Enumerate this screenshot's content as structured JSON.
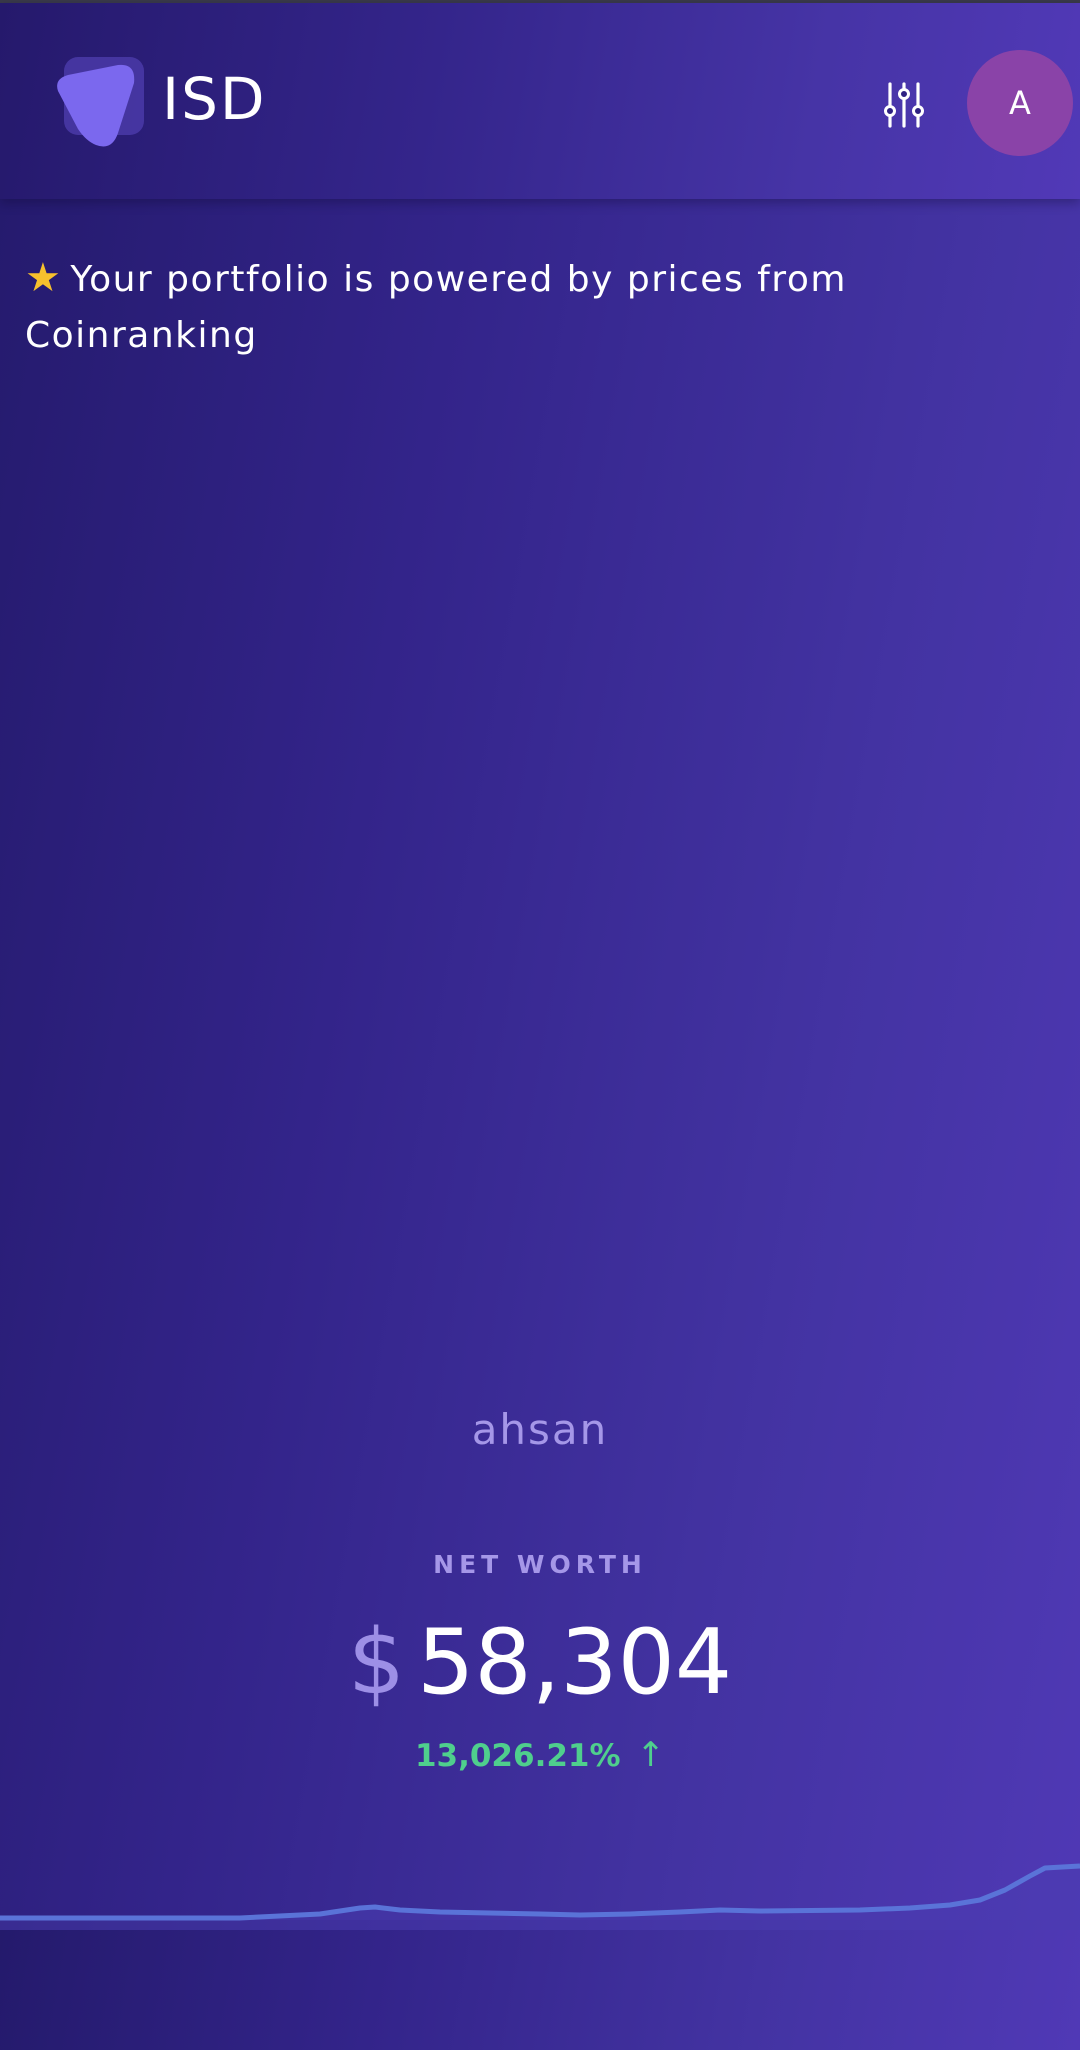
{
  "header": {
    "title": "ISD",
    "filter_icon": "sliders-icon",
    "avatar_initial": "A"
  },
  "notice": {
    "icon": "star-icon",
    "icon_color": "#f7c12d",
    "text": "Your portfolio is powered by prices from Coinranking"
  },
  "portfolio": {
    "name": "ahsan",
    "net_worth_label": "NET WORTH",
    "currency_symbol": "$",
    "net_worth": "58,304",
    "change_percent": "13,026.21%",
    "change_direction": "up",
    "change_arrow": "↑",
    "change_color": "#4fcf8d"
  },
  "colors": {
    "accent": "#7b68ee",
    "avatar_bg": "#8a43a8",
    "sparkline": "#5a73d8"
  }
}
